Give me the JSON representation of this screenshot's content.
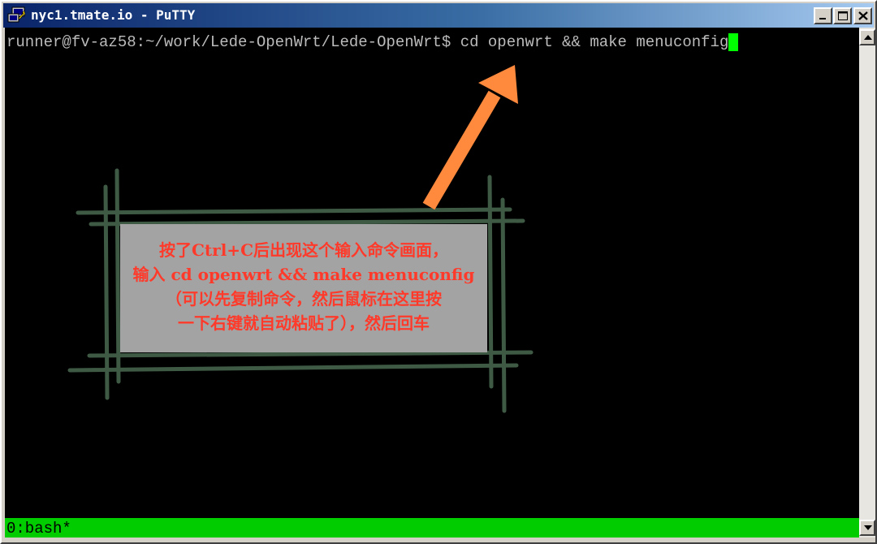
{
  "window": {
    "title": "nyc1.tmate.io - PuTTY"
  },
  "icons": {
    "app": "putty-icon",
    "minimize": "minimize-icon",
    "maximize": "maximize-icon",
    "close": "close-icon",
    "scroll_up": "arrow-up-icon",
    "scroll_down": "arrow-down-icon"
  },
  "terminal": {
    "prompt": "runner@fv-az58:~/work/Lede-OpenWrt/Lede-OpenWrt$",
    "command": "cd openwrt && make menuconfig",
    "status_line": "0:bash*"
  },
  "annotation": {
    "lines": [
      "按了Ctrl+C后出现这个输入命令画面，",
      "输入 cd openwrt && make menuconfig",
      "（可以先复制命令，然后鼠标在这里按",
      "一下右键就自动粘贴了），然后回车"
    ]
  },
  "colors": {
    "terminal_bg": "#000000",
    "terminal_fg": "#bbbbbb",
    "cursor": "#00ff00",
    "status_bar": "#00cc00",
    "arrow": "#ff8a3d",
    "annotation_text": "#ff3a2a",
    "annotation_bg": "#a3a3a3",
    "frame_lines": "#3e5a44"
  }
}
